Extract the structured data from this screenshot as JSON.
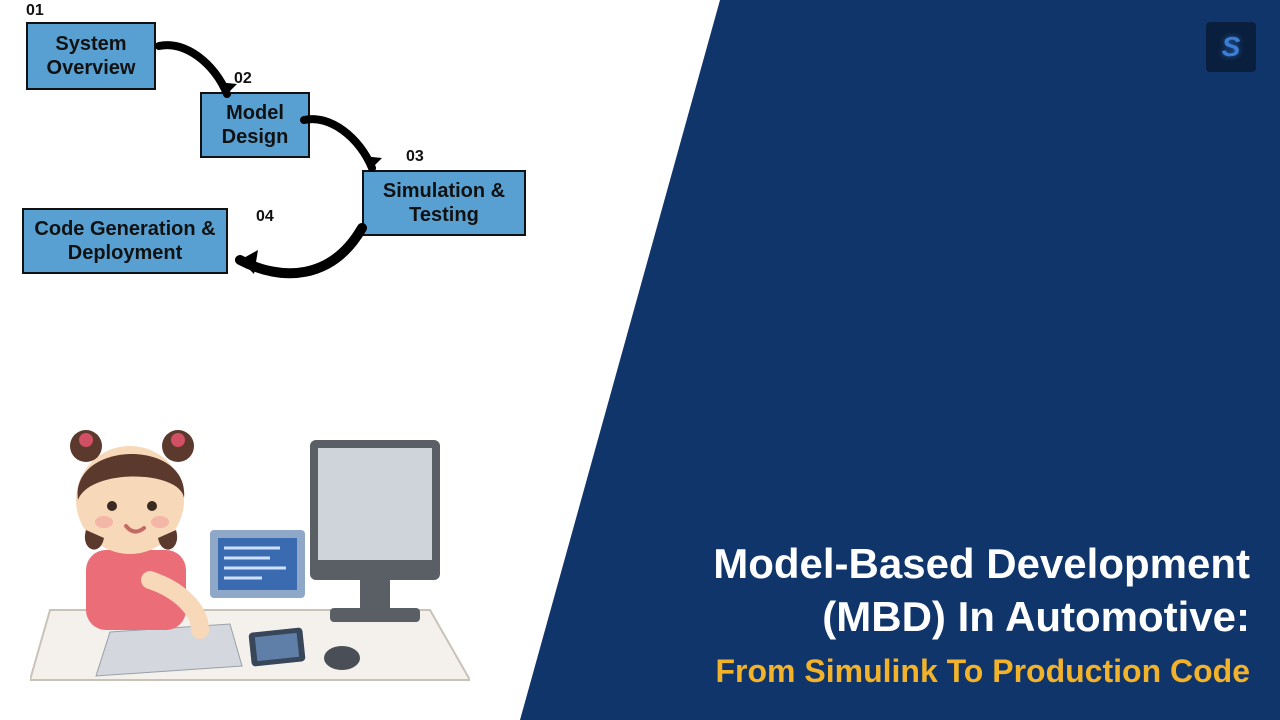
{
  "panel": {
    "title_line1": "Model-Based Development",
    "title_line2": "(MBD) In Automotive:",
    "subtitle": "From Simulink To Production Code"
  },
  "logo": {
    "letter": "S"
  },
  "steps": {
    "s1": {
      "num": "01",
      "label": "System Overview"
    },
    "s2": {
      "num": "02",
      "label": "Model Design"
    },
    "s3": {
      "num": "03",
      "label": "Simulation & Testing"
    },
    "s4": {
      "num": "04",
      "label": "Code Generation & Deployment"
    }
  },
  "colors": {
    "panel_bg": "#10356b",
    "box_bg": "#58a0d1",
    "accent": "#f2b32b"
  }
}
